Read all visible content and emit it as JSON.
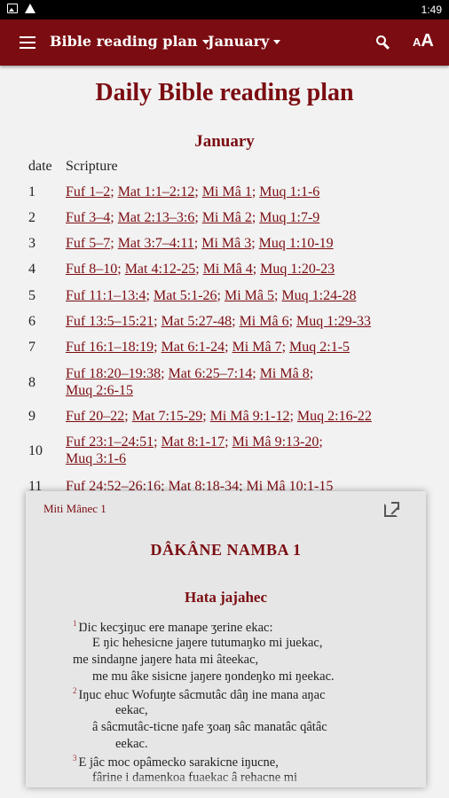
{
  "status_bar": {
    "time": "1:49"
  },
  "app_bar": {
    "plan_dropdown": "Bible reading plan",
    "month_dropdown": "January"
  },
  "page": {
    "title": "Daily Bible reading plan",
    "month": "January",
    "col_date": "date",
    "col_scripture": "Scripture"
  },
  "rows": [
    {
      "day": "1",
      "lines": [
        [
          "Fuf 1–2",
          "Mat 1:1–2:12",
          "Mi Mâ 1",
          "Muq 1:1-6"
        ]
      ]
    },
    {
      "day": "2",
      "lines": [
        [
          "Fuf 3–4",
          "Mat 2:13–3:6",
          "Mi Mâ 2",
          "Muq 1:7-9"
        ]
      ]
    },
    {
      "day": "3",
      "lines": [
        [
          "Fuf 5–7",
          "Mat 3:7–4:11",
          "Mi Mâ 3",
          "Muq 1:10-19"
        ]
      ]
    },
    {
      "day": "4",
      "lines": [
        [
          "Fuf 8–10",
          "Mat 4:12-25",
          "Mi Mâ 4",
          "Muq 1:20-23"
        ]
      ]
    },
    {
      "day": "5",
      "lines": [
        [
          "Fuf 11:1–13:4",
          "Mat 5:1-26",
          "Mi Mâ 5",
          "Muq 1:24-28"
        ]
      ]
    },
    {
      "day": "6",
      "lines": [
        [
          "Fuf 13:5–15:21",
          "Mat 5:27-48",
          "Mi Mâ 6",
          "Muq 1:29-33"
        ]
      ]
    },
    {
      "day": "7",
      "lines": [
        [
          "Fuf 16:1–18:19",
          "Mat 6:1-24",
          "Mi Mâ 7",
          "Muq 2:1-5"
        ]
      ]
    },
    {
      "day": "8",
      "lines": [
        [
          "Fuf 18:20–19:38",
          "Mat 6:25–7:14",
          "Mi Mâ 8"
        ],
        [
          "Muq 2:6-15"
        ]
      ]
    },
    {
      "day": "9",
      "lines": [
        [
          "Fuf 20–22",
          "Mat 7:15-29",
          "Mi Mâ 9:1-12",
          "Muq 2:16-22"
        ]
      ]
    },
    {
      "day": "10",
      "lines": [
        [
          "Fuf 23:1–24:51",
          "Mat 8:1-17",
          "Mi Mâ 9:13-20"
        ],
        [
          "Muq 3:1-6"
        ]
      ]
    },
    {
      "day": "11",
      "lines": [
        [
          "Fuf 24:52–26:16",
          "Mat 8:18-34",
          "Mi Mâ 10:1-15"
        ]
      ]
    }
  ],
  "popup": {
    "title": "Miti Mânec 1",
    "chapter_heading": "DÂKÂNE NAMBA 1",
    "section_heading": "Hata jajahec",
    "lines": [
      {
        "verse": "1",
        "text": "Ŋic kecʒiŋuc ere manape ʒerine ekac:"
      },
      {
        "verse": "",
        "text": "E ŋic hehesicne jaŋere tutumaŋko mi juekac,"
      },
      {
        "verse": "",
        "text": "me sindaŋne jaŋere hata mi âteekac,"
      },
      {
        "verse": "",
        "text": "me mu âke sisicne jaŋere ŋondeŋko mi ŋeekac."
      },
      {
        "verse": "2",
        "text": "Iŋuc ehuc Wofuŋte sâcmutâc dâŋ ine mana aŋac"
      },
      {
        "verse": "",
        "text": "eekac,"
      },
      {
        "verse": "",
        "text": "â sâcmutâc-ticne ŋafe ʒoaŋ sâc manatâc qâtâc"
      },
      {
        "verse": "",
        "text": "eekac."
      },
      {
        "verse": "3",
        "text": "E jâc moc opâmecko sarakicne iŋucne,"
      },
      {
        "verse": "",
        "text": "fârine i damenkoa fuaekac â rehacne mi"
      }
    ]
  }
}
